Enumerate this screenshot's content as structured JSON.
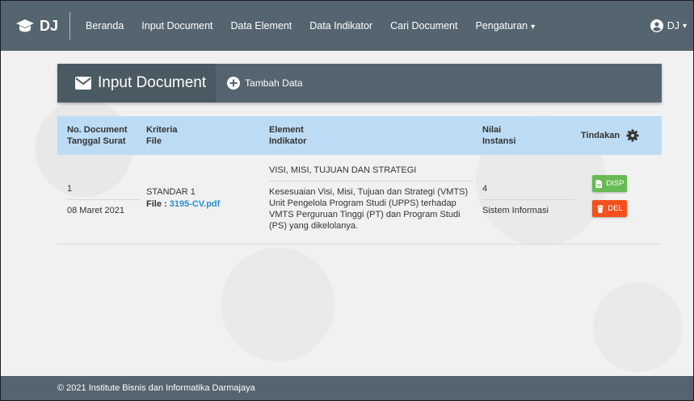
{
  "nav": {
    "brand": "DJ",
    "items": [
      {
        "label": "Beranda"
      },
      {
        "label": "Input Document"
      },
      {
        "label": "Data Element"
      },
      {
        "label": "Data Indikator"
      },
      {
        "label": "Cari Document"
      },
      {
        "label": "Pengaturan"
      }
    ],
    "user_label": "DJ"
  },
  "panel": {
    "title": "Input Document",
    "add_label": "Tambah Data"
  },
  "table": {
    "headers": {
      "col1_line1": "No. Document",
      "col1_line2": "Tanggal Surat",
      "col2_line1": "Kriteria",
      "col2_line2": "File",
      "col3_line1": "Element",
      "col3_line2": "Indikator",
      "col4_line1": "Nilai",
      "col4_line2": "Instansi",
      "col5": "Tindakan"
    },
    "rows": [
      {
        "no": "1",
        "tanggal": "08 Maret 2021",
        "kriteria": "STANDAR 1",
        "file_prefix": "File :",
        "file_name": "3195-CV.pdf",
        "element": "VISI, MISI, TUJUAN DAN STRATEGI",
        "indikator": "Kesesuaian Visi, Misi, Tujuan dan Strategi (VMTS) Unit Pengelola Program Studi (UPPS) terhadap VMTS Perguruan Tinggi (PT) dan Program Studi (PS) yang dikelolanya.",
        "nilai": "4",
        "instansi": "Sistem Informasi",
        "btn_disp": "DISP",
        "btn_del": "DEL"
      }
    ]
  },
  "footer": {
    "text": "© 2021 Institute Bisnis dan Informatika Darmajaya"
  },
  "colors": {
    "navbar": "#55656f",
    "table_header": "#bcdcf5",
    "disp_button": "#66bb52",
    "del_button": "#f4511e",
    "link": "#2b8fd6"
  }
}
